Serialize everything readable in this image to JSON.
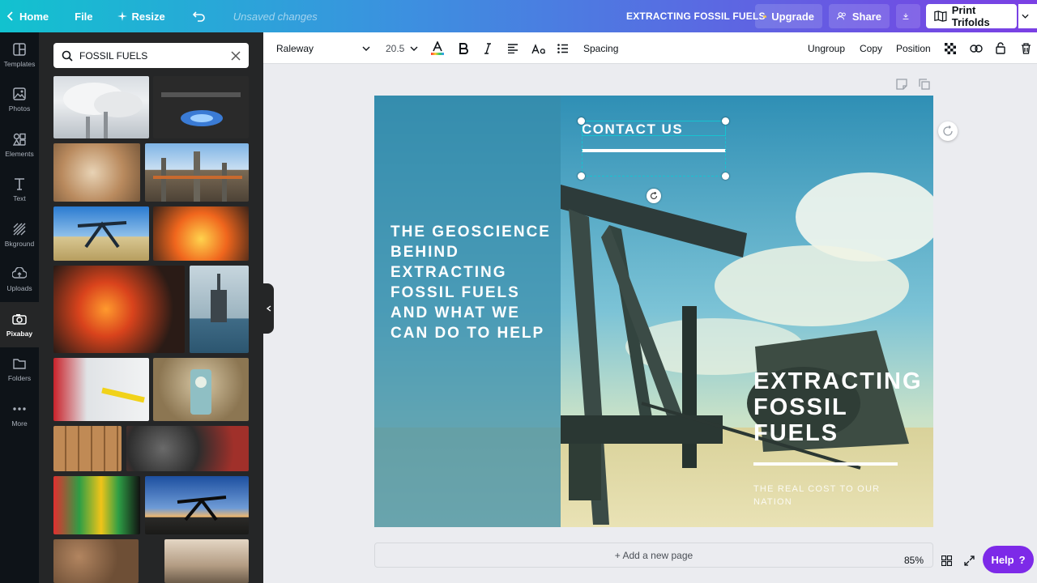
{
  "topbar": {
    "home_label": "Home",
    "file_label": "File",
    "resize_label": "Resize",
    "unsaved_text": "Unsaved changes",
    "doc_title": "EXTRACTING FOSSIL FUELS",
    "upgrade_label": "Upgrade",
    "share_label": "Share",
    "print_label": "Print Trifolds"
  },
  "rail": {
    "items": [
      {
        "label": "Templates",
        "icon": "templates-icon"
      },
      {
        "label": "Photos",
        "icon": "photos-icon"
      },
      {
        "label": "Elements",
        "icon": "elements-icon"
      },
      {
        "label": "Text",
        "icon": "text-icon"
      },
      {
        "label": "Bkground",
        "icon": "background-icon"
      },
      {
        "label": "Uploads",
        "icon": "uploads-icon"
      },
      {
        "label": "Pixabay",
        "icon": "pixabay-icon"
      },
      {
        "label": "Folders",
        "icon": "folders-icon"
      },
      {
        "label": "More",
        "icon": "more-icon"
      }
    ],
    "active_index": 6
  },
  "panel": {
    "search_value": "FOSSIL FUELS"
  },
  "toolbar": {
    "font_family": "Raleway",
    "font_size": "20.5",
    "spacing_label": "Spacing",
    "ungroup_label": "Ungroup",
    "copy_label": "Copy",
    "position_label": "Position"
  },
  "design": {
    "left_text": "THE GEOSCIENCE BEHIND EXTRACTING FOSSIL FUELS AND WHAT WE CAN DO TO HELP",
    "contact_text": "CONTACT US",
    "title_line1": "EXTRACTING",
    "title_line2": "FOSSIL",
    "title_line3": "FUELS",
    "subtitle": "THE REAL COST TO OUR NATION"
  },
  "footer": {
    "add_page_label": "+ Add a new page",
    "zoom_level": "85%",
    "help_label": "Help",
    "help_glyph": "?"
  },
  "colors": {
    "accent_purple": "#7d2ae8",
    "selection_cyan": "#17c3d1"
  }
}
